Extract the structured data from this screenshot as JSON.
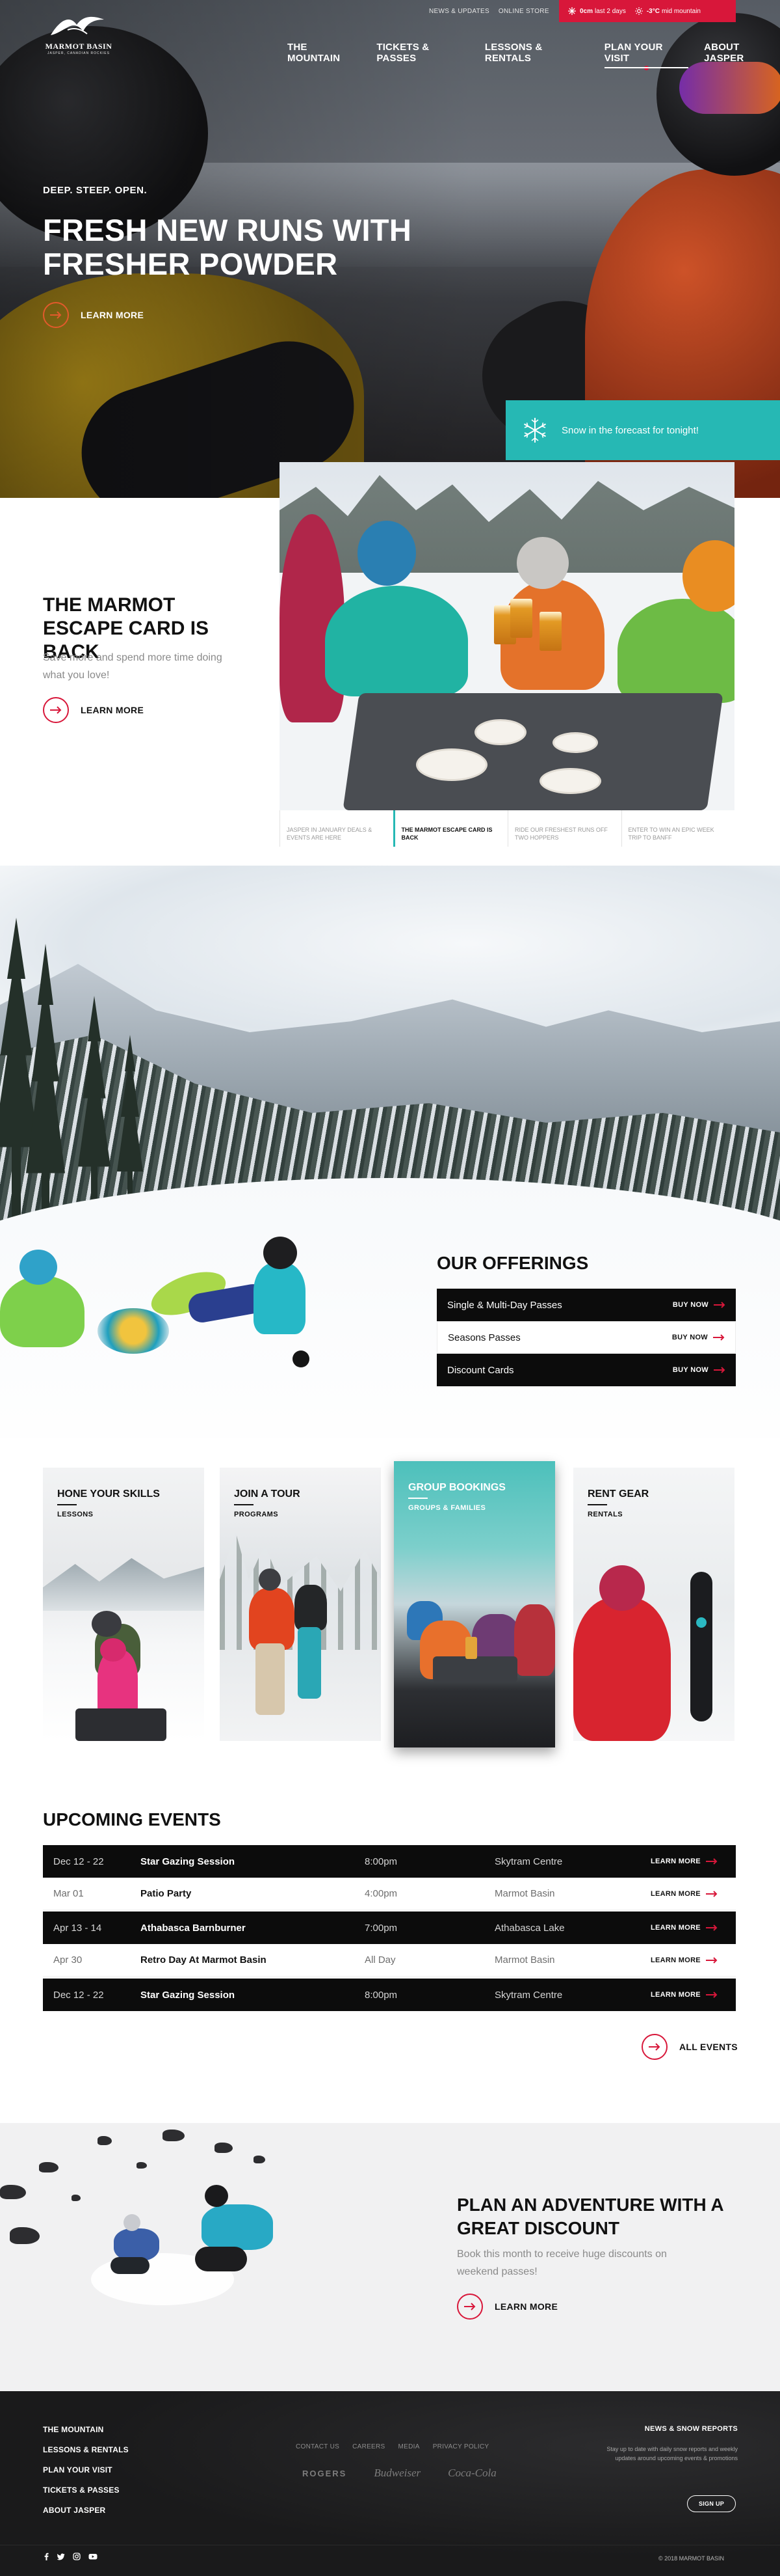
{
  "brand": {
    "name": "MARMOT BASIN",
    "tagline": "JASPER, CANADIAN ROCKIES"
  },
  "header": {
    "utility_links": [
      "NEWS & UPDATES",
      "ONLINE STORE"
    ],
    "snow_report": {
      "amount": "0cm",
      "amount_note": "last 2 days",
      "temp": "-3°C",
      "temp_note": "mid mountain"
    },
    "nav": [
      {
        "label": "THE MOUNTAIN",
        "active": false
      },
      {
        "label": "TICKETS & PASSES",
        "active": false
      },
      {
        "label": "LESSONS & RENTALS",
        "active": false
      },
      {
        "label": "PLAN YOUR VISIT",
        "active": true
      },
      {
        "label": "ABOUT JASPER",
        "active": false
      }
    ]
  },
  "hero": {
    "kicker": "DEEP. STEEP. OPEN.",
    "title": "FRESH NEW RUNS WITH FRESHER POWDER",
    "cta": "LEARN MORE",
    "forecast": "Snow in the forecast for tonight!"
  },
  "escape": {
    "title": "THE MARMOT ESCAPE CARD IS BACK",
    "text": "Save more and spend more time doing what you love!",
    "cta": "LEARN MORE",
    "tabs": [
      "JASPER IN JANUARY DEALS & EVENTS ARE HERE",
      "THE MARMOT ESCAPE CARD IS BACK",
      "RIDE OUR FRESHEST RUNS OFF TWO HOPPERS",
      "ENTER TO WIN AN EPIC WEEK TRIP TO BANFF"
    ],
    "active_tab": 1
  },
  "offerings": {
    "title": "OUR OFFERINGS",
    "items": [
      {
        "label": "Single & Multi-Day Passes",
        "action": "BUY NOW",
        "style": "dark"
      },
      {
        "label": "Seasons Passes",
        "action": "BUY NOW",
        "style": "light"
      },
      {
        "label": "Discount Cards",
        "action": "BUY NOW",
        "style": "dark"
      }
    ]
  },
  "programs": [
    {
      "title": "HONE YOUR SKILLS",
      "subtitle": "LESSONS"
    },
    {
      "title": "JOIN A TOUR",
      "subtitle": "PROGRAMS"
    },
    {
      "title": "GROUP BOOKINGS",
      "subtitle": "GROUPS & FAMILIES"
    },
    {
      "title": "RENT GEAR",
      "subtitle": "RENTALS"
    }
  ],
  "events": {
    "title": "UPCOMING EVENTS",
    "rows": [
      {
        "date": "Dec 12 - 22",
        "name": "Star Gazing Session",
        "time": "8:00pm",
        "location": "Skytram Centre",
        "action": "LEARN MORE",
        "style": "dark"
      },
      {
        "date": "Mar 01",
        "name": "Patio Party",
        "time": "4:00pm",
        "location": "Marmot Basin",
        "action": "LEARN MORE",
        "style": "light"
      },
      {
        "date": "Apr 13 - 14",
        "name": "Athabasca Barnburner",
        "time": "7:00pm",
        "location": "Athabasca Lake",
        "action": "LEARN MORE",
        "style": "dark"
      },
      {
        "date": "Apr 30",
        "name": "Retro Day At Marmot Basin",
        "time": "All Day",
        "location": "Marmot Basin",
        "action": "LEARN MORE",
        "style": "light"
      },
      {
        "date": "Dec 12 - 22",
        "name": "Star Gazing Session",
        "time": "8:00pm",
        "location": "Skytram Centre",
        "action": "LEARN MORE",
        "style": "dark"
      }
    ],
    "all_label": "ALL EVENTS"
  },
  "adventure": {
    "title": "PLAN AN ADVENTURE WITH A GREAT DISCOUNT",
    "text": "Book this month to receive huge discounts on weekend passes!",
    "cta": "LEARN MORE"
  },
  "footer": {
    "nav": [
      "THE MOUNTAIN",
      "LESSONS & RENTALS",
      "PLAN YOUR VISIT",
      "TICKETS & PASSES",
      "ABOUT JASPER"
    ],
    "links": [
      "CONTACT US",
      "CAREERS",
      "MEDIA",
      "PRIVACY POLICY"
    ],
    "sponsors": [
      "ROGERS",
      "Budweiser",
      "Coca-Cola"
    ],
    "news_title": "NEWS & SNOW REPORTS",
    "news_text": "Stay up to date with daily snow reports and weekly updates around upcoming events & promotions",
    "signup": "SIGN UP",
    "social": [
      "facebook-icon",
      "twitter-icon",
      "instagram-icon",
      "youtube-icon"
    ],
    "copyright": "© 2018 MARMOT BASIN"
  },
  "colors": {
    "accent_red": "#d8173a",
    "teal": "#26b8b4",
    "dark": "#0c0c0c"
  }
}
